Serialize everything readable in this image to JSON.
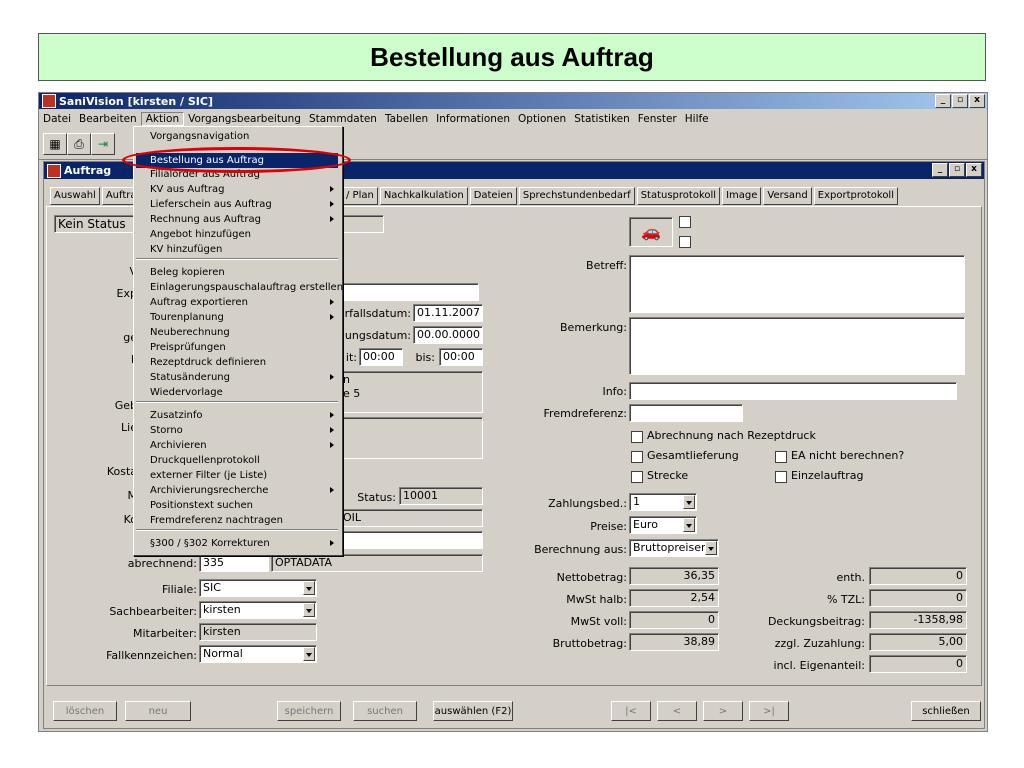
{
  "slide": {
    "title": "Bestellung aus Auftrag"
  },
  "app": {
    "title": "SaniVision [kirsten / SIC]",
    "menu": [
      "Datei",
      "Bearbeiten",
      "Aktion",
      "Vorgangsbearbeitung",
      "Stammdaten",
      "Tabellen",
      "Informationen",
      "Optionen",
      "Statistiken",
      "Fenster",
      "Hilfe"
    ],
    "window_buttons": [
      "_",
      "▫",
      "x"
    ]
  },
  "inner_window": {
    "title": "Auftrag",
    "tabs": [
      "Auswahl",
      "Auftra",
      "/ Plan",
      "Nachkalkulation",
      "Dateien",
      "Sprechstundenbedarf",
      "Statusprotokoll",
      "Image",
      "Versand",
      "Exportprotokoll"
    ]
  },
  "dropdown": {
    "items": [
      {
        "label": "Vorgangsnavigation",
        "arrow": false
      },
      {
        "label": "Bestellung aus Auftrag",
        "arrow": false,
        "selected": true
      },
      {
        "label": "Filialorder aus Auftrag",
        "arrow": false
      },
      {
        "label": "KV aus Auftrag",
        "arrow": true
      },
      {
        "label": "Lieferschein aus Auftrag",
        "arrow": true
      },
      {
        "label": "Rechnung aus Auftrag",
        "arrow": true
      },
      {
        "label": "Angebot hinzufügen",
        "arrow": false
      },
      {
        "label": "KV hinzufügen",
        "arrow": false
      },
      {
        "label": "Beleg kopieren",
        "arrow": false
      },
      {
        "label": "Einlagerungspauschalauftrag erstellen",
        "arrow": false
      },
      {
        "label": "Auftrag exportieren",
        "arrow": true
      },
      {
        "label": "Tourenplanung",
        "arrow": true
      },
      {
        "label": "Neuberechnung",
        "arrow": false
      },
      {
        "label": "Preisprüfungen",
        "arrow": false
      },
      {
        "label": "Rezeptdruck definieren",
        "arrow": false
      },
      {
        "label": "Statusänderung",
        "arrow": true
      },
      {
        "label": "Wiedervorlage",
        "arrow": false
      },
      {
        "label": "Zusatzinfo",
        "arrow": true
      },
      {
        "label": "Storno",
        "arrow": true
      },
      {
        "label": "Archivieren",
        "arrow": true
      },
      {
        "label": "Druckquellenprotokoll",
        "arrow": false
      },
      {
        "label": "externer Filter (je Liste)",
        "arrow": false
      },
      {
        "label": "Archivierungsrecherche",
        "arrow": true
      },
      {
        "label": "Positionstext suchen",
        "arrow": false
      },
      {
        "label": "Fremdreferenz nachtragen",
        "arrow": false
      },
      {
        "label": "§300 / §302 Korrekturen",
        "arrow": true
      }
    ]
  },
  "left": {
    "status_box": "Kein Status",
    "partial_labels": [
      "V",
      "Exp",
      "ge",
      "L",
      "Geb",
      "Lie",
      "Kosta",
      "M",
      "Ko"
    ],
    "frag_t1": "t",
    "frag_t2": "rt",
    "verfall_label": "erfallsdatum:",
    "verfall_value": "01.11.2007",
    "lieferung_label": "ungsdatum:",
    "lieferung_value": "00.00.0000",
    "zeit_label": "it:",
    "zeit_from": "00:00",
    "bis_label": "bis:",
    "zeit_to": "00:00",
    "addr1": "n",
    "addr2": "e 5",
    "status_label": "Status:",
    "status_value": "10001",
    "oil_value": "OIL",
    "abrechnend_label": "abrechnend:",
    "abrechnend_value": "335",
    "abrechnend_name": "OPTADATA",
    "filiale_label": "Filiale:",
    "filiale_value": "SIC",
    "sachbearbeiter_label": "Sachbearbeiter:",
    "sachbearbeiter_value": "kirsten",
    "mitarbeiter_label": "Mitarbeiter:",
    "mitarbeiter_value": "kirsten",
    "fallkennzeichen_label": "Fallkennzeichen:",
    "fallkennzeichen_value": "Normal"
  },
  "right": {
    "betreff_label": "Betreff:",
    "bemerkung_label": "Bemerkung:",
    "info_label": "Info:",
    "fremdreferenz_label": "Fremdreferenz:",
    "cb_rezeptdruck": "Abrechnung nach Rezeptdruck",
    "cb_gesamtlieferung": "Gesamtlieferung",
    "cb_ea": "EA nicht berechnen?",
    "cb_strecke": "Strecke",
    "cb_einzelauftrag": "Einzelauftrag",
    "zahlungsbed_label": "Zahlungsbed.:",
    "zahlungsbed_value": "1",
    "preise_label": "Preise:",
    "preise_value": "Euro",
    "berechnung_label": "Berechnung aus:",
    "berechnung_value": "Bruttopreisen",
    "netto_label": "Nettobetrag:",
    "netto_value": "36,35",
    "mwst_halb_label": "MwSt halb:",
    "mwst_halb_value": "2,54",
    "mwst_voll_label": "MwSt voll:",
    "mwst_voll_value": "0",
    "brutto_label": "Bruttobetrag:",
    "brutto_value": "38,89",
    "enth_label": "enth.",
    "enth_value": "0",
    "tzl_label": "% TZL:",
    "tzl_value": "0",
    "deckung_label": "Deckungsbeitrag:",
    "deckung_value": "-1358,98",
    "zuzahlung_label": "zzgl. Zuzahlung:",
    "zuzahlung_value": "5,00",
    "eigenanteil_label": "incl. Eigenanteil:",
    "eigenanteil_value": "0"
  },
  "buttons": {
    "loeschen": "löschen",
    "neu": "neu",
    "speichern": "speichern",
    "suchen": "suchen",
    "auswaehlen": "auswählen (F2)",
    "first": "|<",
    "prev": "<",
    "next": ">",
    "last": ">|",
    "schliessen": "schließen"
  }
}
